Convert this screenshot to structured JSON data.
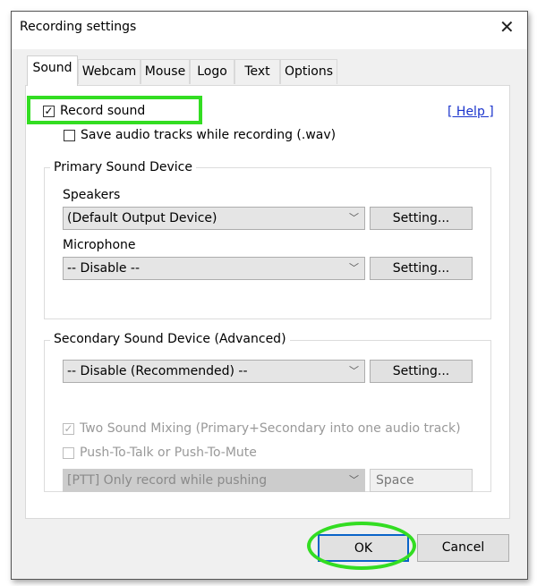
{
  "window": {
    "title": "Recording settings",
    "close_icon": "close-icon"
  },
  "tabs": [
    {
      "label": "Sound",
      "active": true
    },
    {
      "label": "Webcam"
    },
    {
      "label": "Mouse"
    },
    {
      "label": "Logo"
    },
    {
      "label": "Text"
    },
    {
      "label": "Options"
    }
  ],
  "sound": {
    "record_sound": {
      "label": "Record sound",
      "checked": true
    },
    "save_audio": {
      "label": "Save audio tracks while recording (.wav)",
      "checked": false
    },
    "help_link": "[ Help ]",
    "primary": {
      "title": "Primary Sound Device",
      "speakers_label": "Speakers",
      "speakers_value": "(Default Output Device)",
      "microphone_label": "Microphone",
      "microphone_value": "-- Disable --",
      "setting_label": "Setting..."
    },
    "secondary": {
      "title": "Secondary Sound Device (Advanced)",
      "device_value": "-- Disable (Recommended) --",
      "setting_label": "Setting...",
      "two_sound_mixing": {
        "label": "Two Sound Mixing (Primary+Secondary into one audio track)",
        "checked": true,
        "disabled": true
      },
      "push_to_talk": {
        "label": "Push-To-Talk or Push-To-Mute",
        "checked": false,
        "disabled": true
      },
      "ptt_mode_value": "[PTT] Only record while pushing",
      "ptt_key": "Space"
    }
  },
  "footer": {
    "ok_label": "OK",
    "cancel_label": "Cancel"
  },
  "highlight_color": "#33dd22"
}
